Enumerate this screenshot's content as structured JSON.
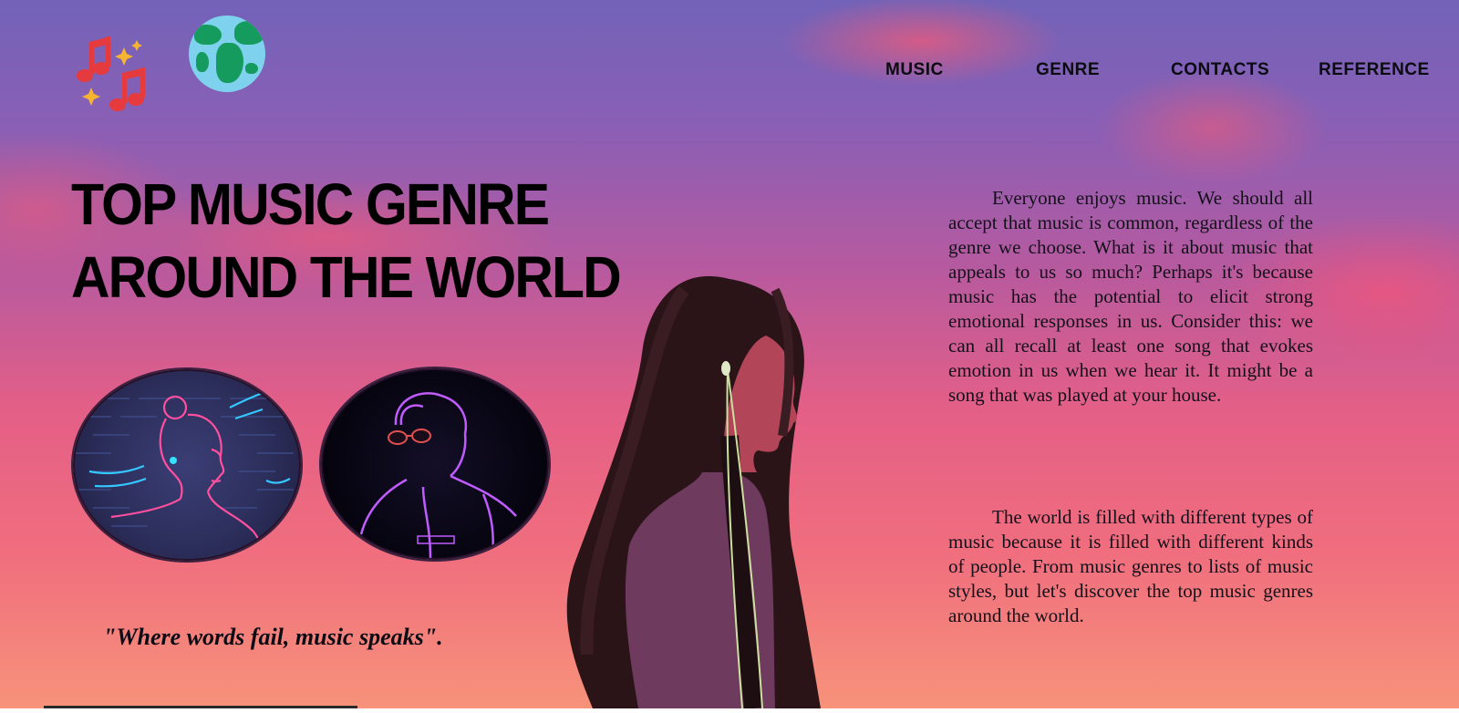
{
  "header": {
    "logo_icon": "music-notes-icon",
    "globe_icon": "globe-icon",
    "nav": [
      {
        "label": "MUSIC"
      },
      {
        "label": "GENRE"
      },
      {
        "label": "CONTACTS"
      },
      {
        "label": "REFERENCE"
      }
    ]
  },
  "hero": {
    "title_line1": "TOP MUSIC GENRE",
    "title_line2": "AROUND THE WORLD",
    "quote": "\"Where words fail, music speaks\"."
  },
  "content": {
    "paragraph1": "Everyone enjoys music. We should all accept that music is common, regardless of the genre we choose. What is it about music that appeals to us so much? Perhaps it's because music has the potential to elicit strong emotional responses in us. Consider this: we can all recall at least one song that evokes emotion in us when we hear it. It might be a song that was played at your house.",
    "paragraph2": "The world is filled with different types of music because it is filled with different kinds of people. From music genres to lists of music styles, but let's discover the top music genres around the world."
  },
  "colors": {
    "accent_red": "#e0383b",
    "neon_pink": "#ff4fb0",
    "neon_blue": "#35c8ff",
    "neon_purple": "#b94bff"
  }
}
